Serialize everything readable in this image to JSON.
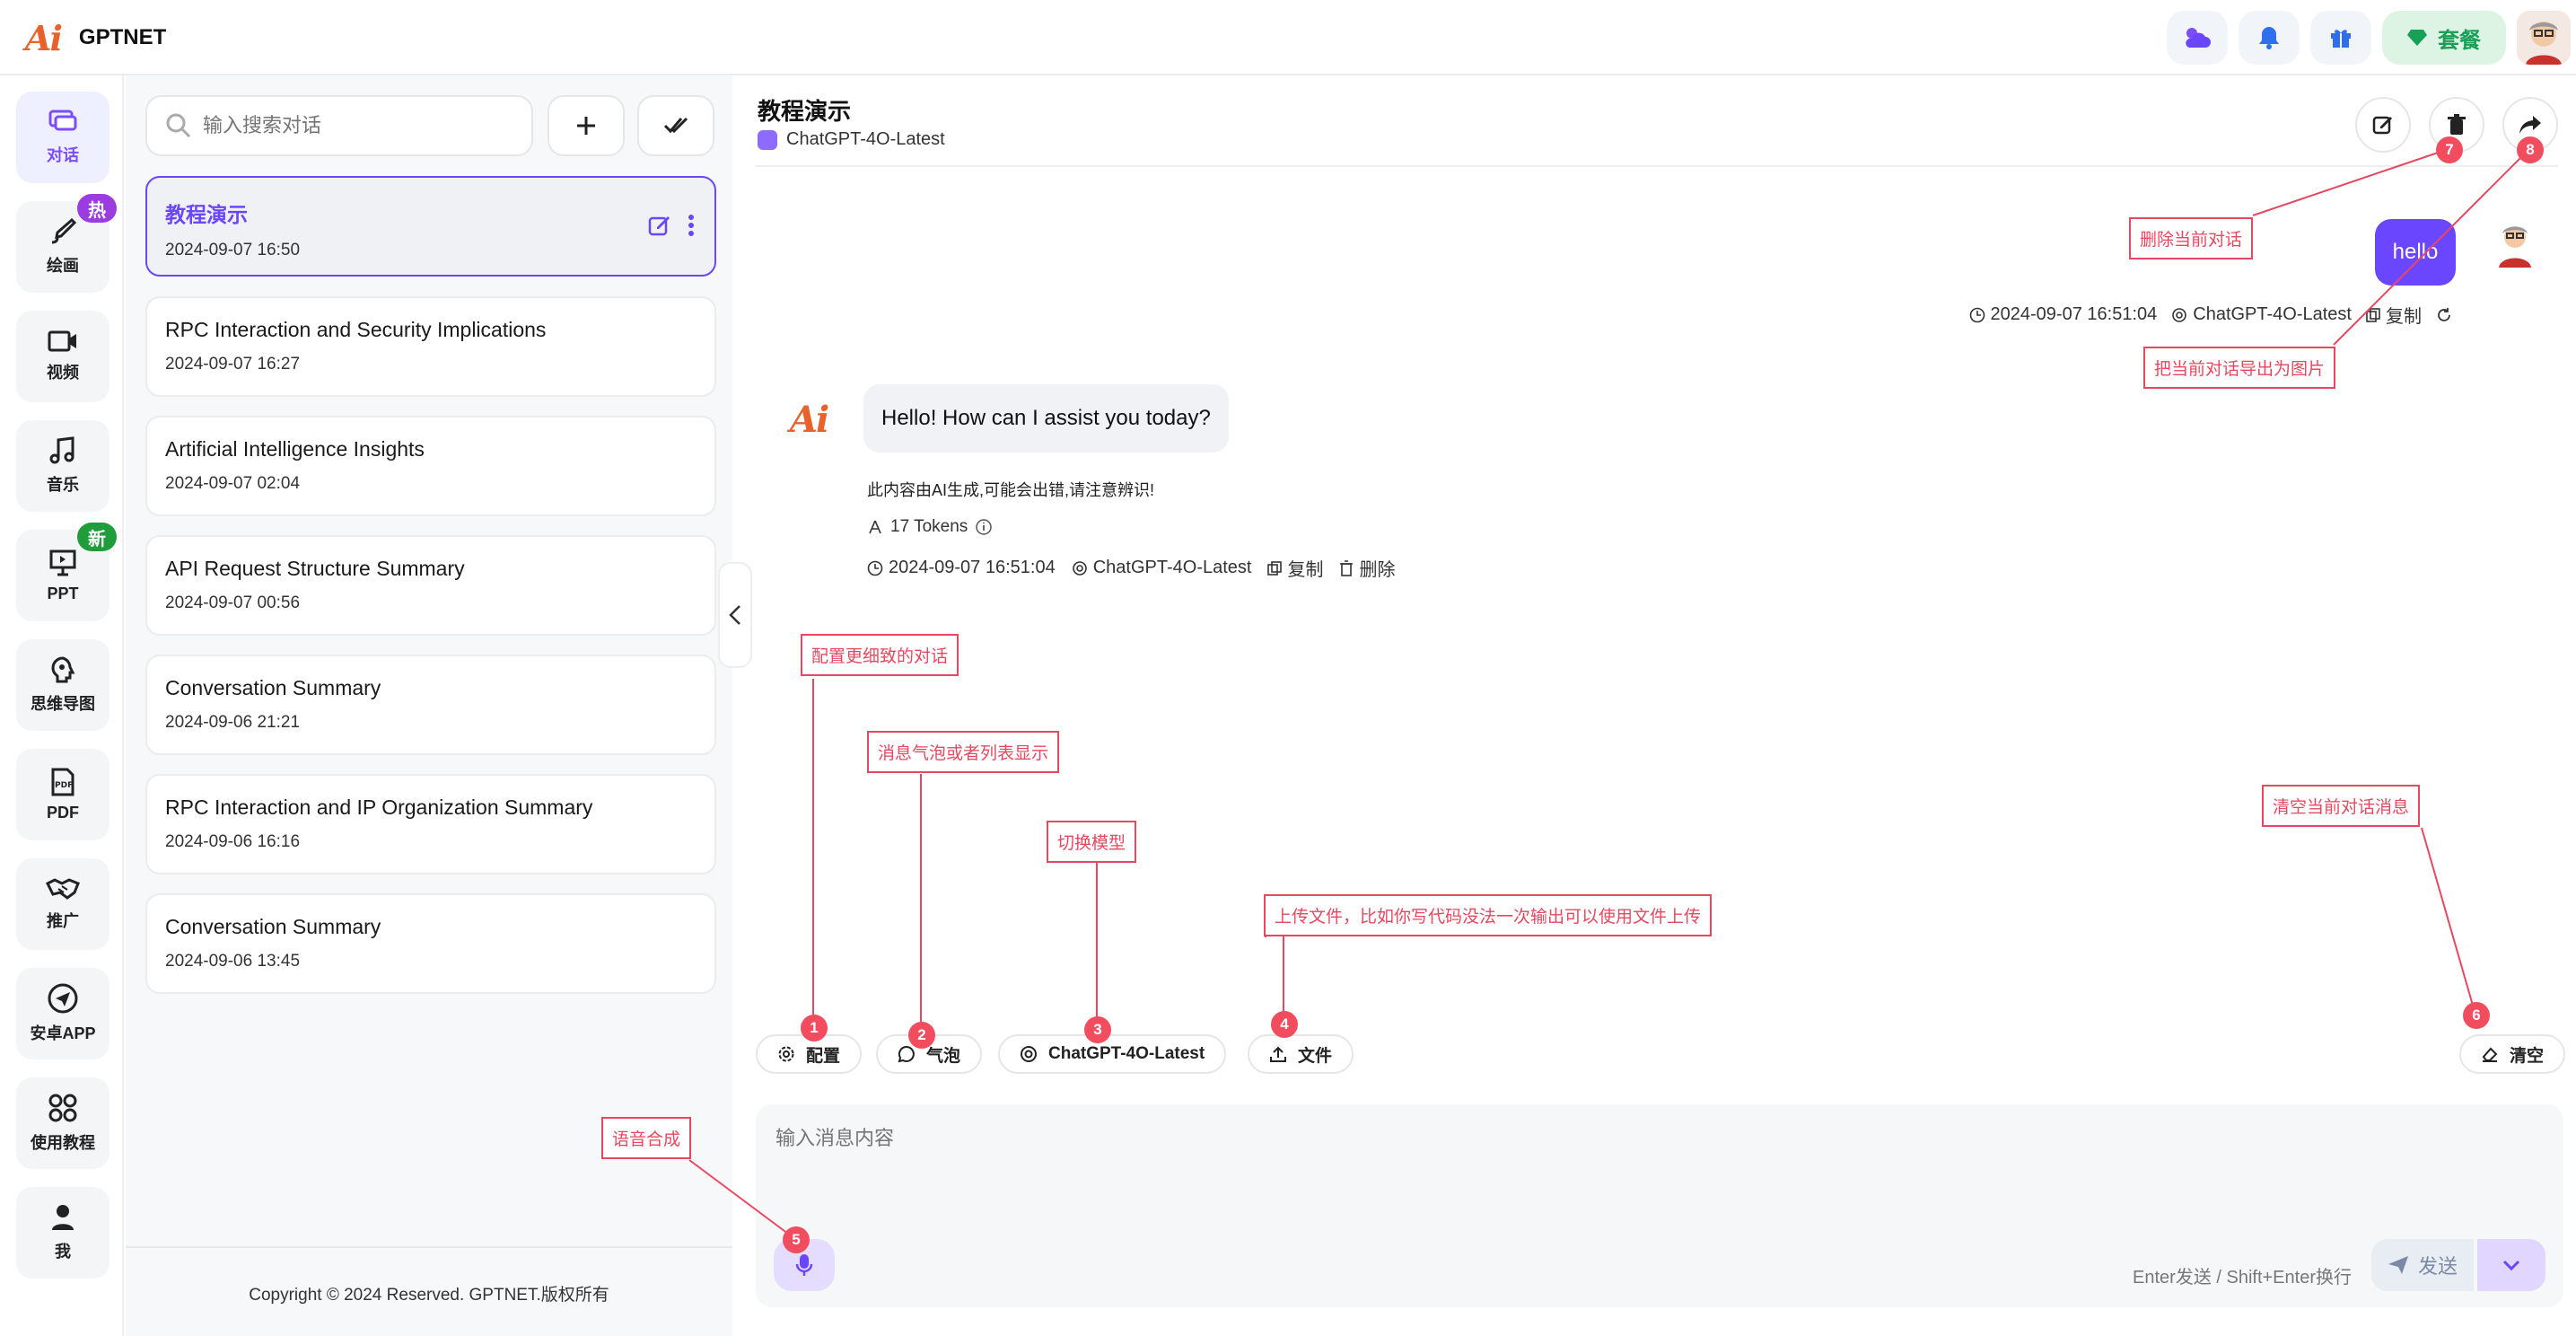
{
  "app": {
    "logo_mark": "Ai",
    "name": "GPTNET"
  },
  "topbar": {
    "package_label": "套餐"
  },
  "nav": [
    {
      "label": "对话",
      "icon": "chat-icon",
      "badge": ""
    },
    {
      "label": "绘画",
      "icon": "paint-brush-icon",
      "badge": "热"
    },
    {
      "label": "视频",
      "icon": "video-icon",
      "badge": ""
    },
    {
      "label": "音乐",
      "icon": "music-icon",
      "badge": ""
    },
    {
      "label": "PPT",
      "icon": "presentation-icon",
      "badge": "新"
    },
    {
      "label": "思维导图",
      "icon": "mind-map-icon",
      "badge": ""
    },
    {
      "label": "PDF",
      "icon": "pdf-icon",
      "badge": ""
    },
    {
      "label": "推广",
      "icon": "handshake-icon",
      "badge": ""
    },
    {
      "label": "安卓APP",
      "icon": "send-plane-icon",
      "badge": ""
    },
    {
      "label": "使用教程",
      "icon": "grid-icon",
      "badge": ""
    },
    {
      "label": "我",
      "icon": "user-icon",
      "badge": ""
    }
  ],
  "conversation_list": {
    "search_placeholder": "输入搜索对话",
    "items": [
      {
        "title": "教程演示",
        "date": "2024-09-07 16:50"
      },
      {
        "title": "RPC Interaction and Security Implications",
        "date": "2024-09-07 16:27"
      },
      {
        "title": "Artificial Intelligence Insights",
        "date": "2024-09-07 02:04"
      },
      {
        "title": "API Request Structure Summary",
        "date": "2024-09-07 00:56"
      },
      {
        "title": "Conversation Summary",
        "date": "2024-09-06 21:21"
      },
      {
        "title": "RPC Interaction and IP Organization Summary",
        "date": "2024-09-06 16:16"
      },
      {
        "title": "Conversation Summary",
        "date": "2024-09-06 13:45"
      }
    ],
    "copyright": "Copyright © 2024 Reserved. GPTNET.版权所有"
  },
  "chat": {
    "title": "教程演示",
    "model": "ChatGPT-4O-Latest",
    "user_message": {
      "text": "hello",
      "time": "2024-09-07 16:51:04",
      "model": "ChatGPT-4O-Latest",
      "copy": "复制"
    },
    "ai_message": {
      "text": "Hello! How can I assist you today?",
      "note": "此内容由AI生成,可能会出错,请注意辨识!",
      "tokens": "17 Tokens",
      "time": "2024-09-07 16:51:04",
      "model": "ChatGPT-4O-Latest",
      "copy": "复制",
      "delete": "删除"
    }
  },
  "toolbar": {
    "config": "配置",
    "bubble": "气泡",
    "model": "ChatGPT-4O-Latest",
    "file": "文件",
    "clear": "清空"
  },
  "composer": {
    "placeholder": "输入消息内容",
    "hint": "Enter发送 / Shift+Enter换行",
    "send": "发送"
  },
  "annotations": {
    "n1": "配置更细致的对话",
    "n2": "消息气泡或者列表显示",
    "n3": "切换模型",
    "n4": "上传文件，比如你写代码没法一次输出可以使用文件上传",
    "n5": "语音合成",
    "n6": "清空当前对话消息",
    "n7": "删除当前对话",
    "n8": "把当前对话导出为图片",
    "dots": [
      "1",
      "2",
      "3",
      "4",
      "5",
      "6",
      "7",
      "8"
    ]
  },
  "colors": {
    "accent": "#6b46ff",
    "annotation": "#e7485f",
    "logo": "#e8632b",
    "package": "#18a058"
  }
}
